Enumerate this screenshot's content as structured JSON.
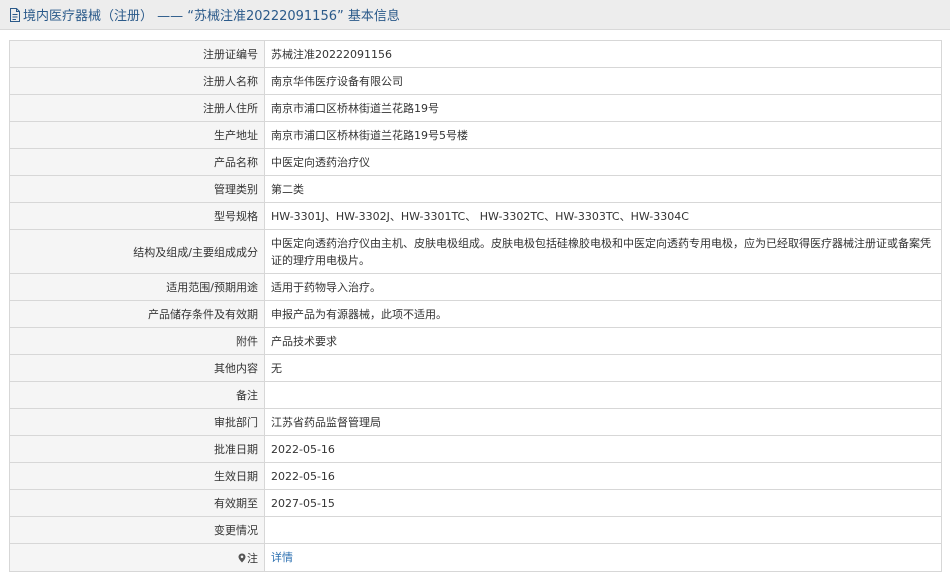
{
  "header": {
    "title": "境内医疗器械（注册） —— “苏械注准20222091156” 基本信息"
  },
  "rows": [
    {
      "label": "注册证编号",
      "value": "苏械注准20222091156"
    },
    {
      "label": "注册人名称",
      "value": "南京华伟医疗设备有限公司"
    },
    {
      "label": "注册人住所",
      "value": "南京市浦口区桥林街道兰花路19号"
    },
    {
      "label": "生产地址",
      "value": "南京市浦口区桥林街道兰花路19号5号楼"
    },
    {
      "label": "产品名称",
      "value": "中医定向透药治疗仪"
    },
    {
      "label": "管理类别",
      "value": "第二类"
    },
    {
      "label": "型号规格",
      "value": "HW-3301J、HW-3302J、HW-3301TC、 HW-3302TC、HW-3303TC、HW-3304C"
    },
    {
      "label": "结构及组成/主要组成成分",
      "value": "中医定向透药治疗仪由主机、皮肤电极组成。皮肤电极包括硅橡胶电极和中医定向透药专用电极，应为已经取得医疗器械注册证或备案凭证的理疗用电极片。"
    },
    {
      "label": "适用范围/预期用途",
      "value": "适用于药物导入治疗。"
    },
    {
      "label": "产品储存条件及有效期",
      "value": "申报产品为有源器械，此项不适用。"
    },
    {
      "label": "附件",
      "value": "产品技术要求"
    },
    {
      "label": "其他内容",
      "value": "无"
    },
    {
      "label": "备注",
      "value": ""
    },
    {
      "label": "审批部门",
      "value": "江苏省药品监督管理局"
    },
    {
      "label": "批准日期",
      "value": "2022-05-16"
    },
    {
      "label": "生效日期",
      "value": "2022-05-16"
    },
    {
      "label": "有效期至",
      "value": "2027-05-15"
    },
    {
      "label": "变更情况",
      "value": ""
    },
    {
      "label": "注",
      "value": "详情"
    }
  ]
}
